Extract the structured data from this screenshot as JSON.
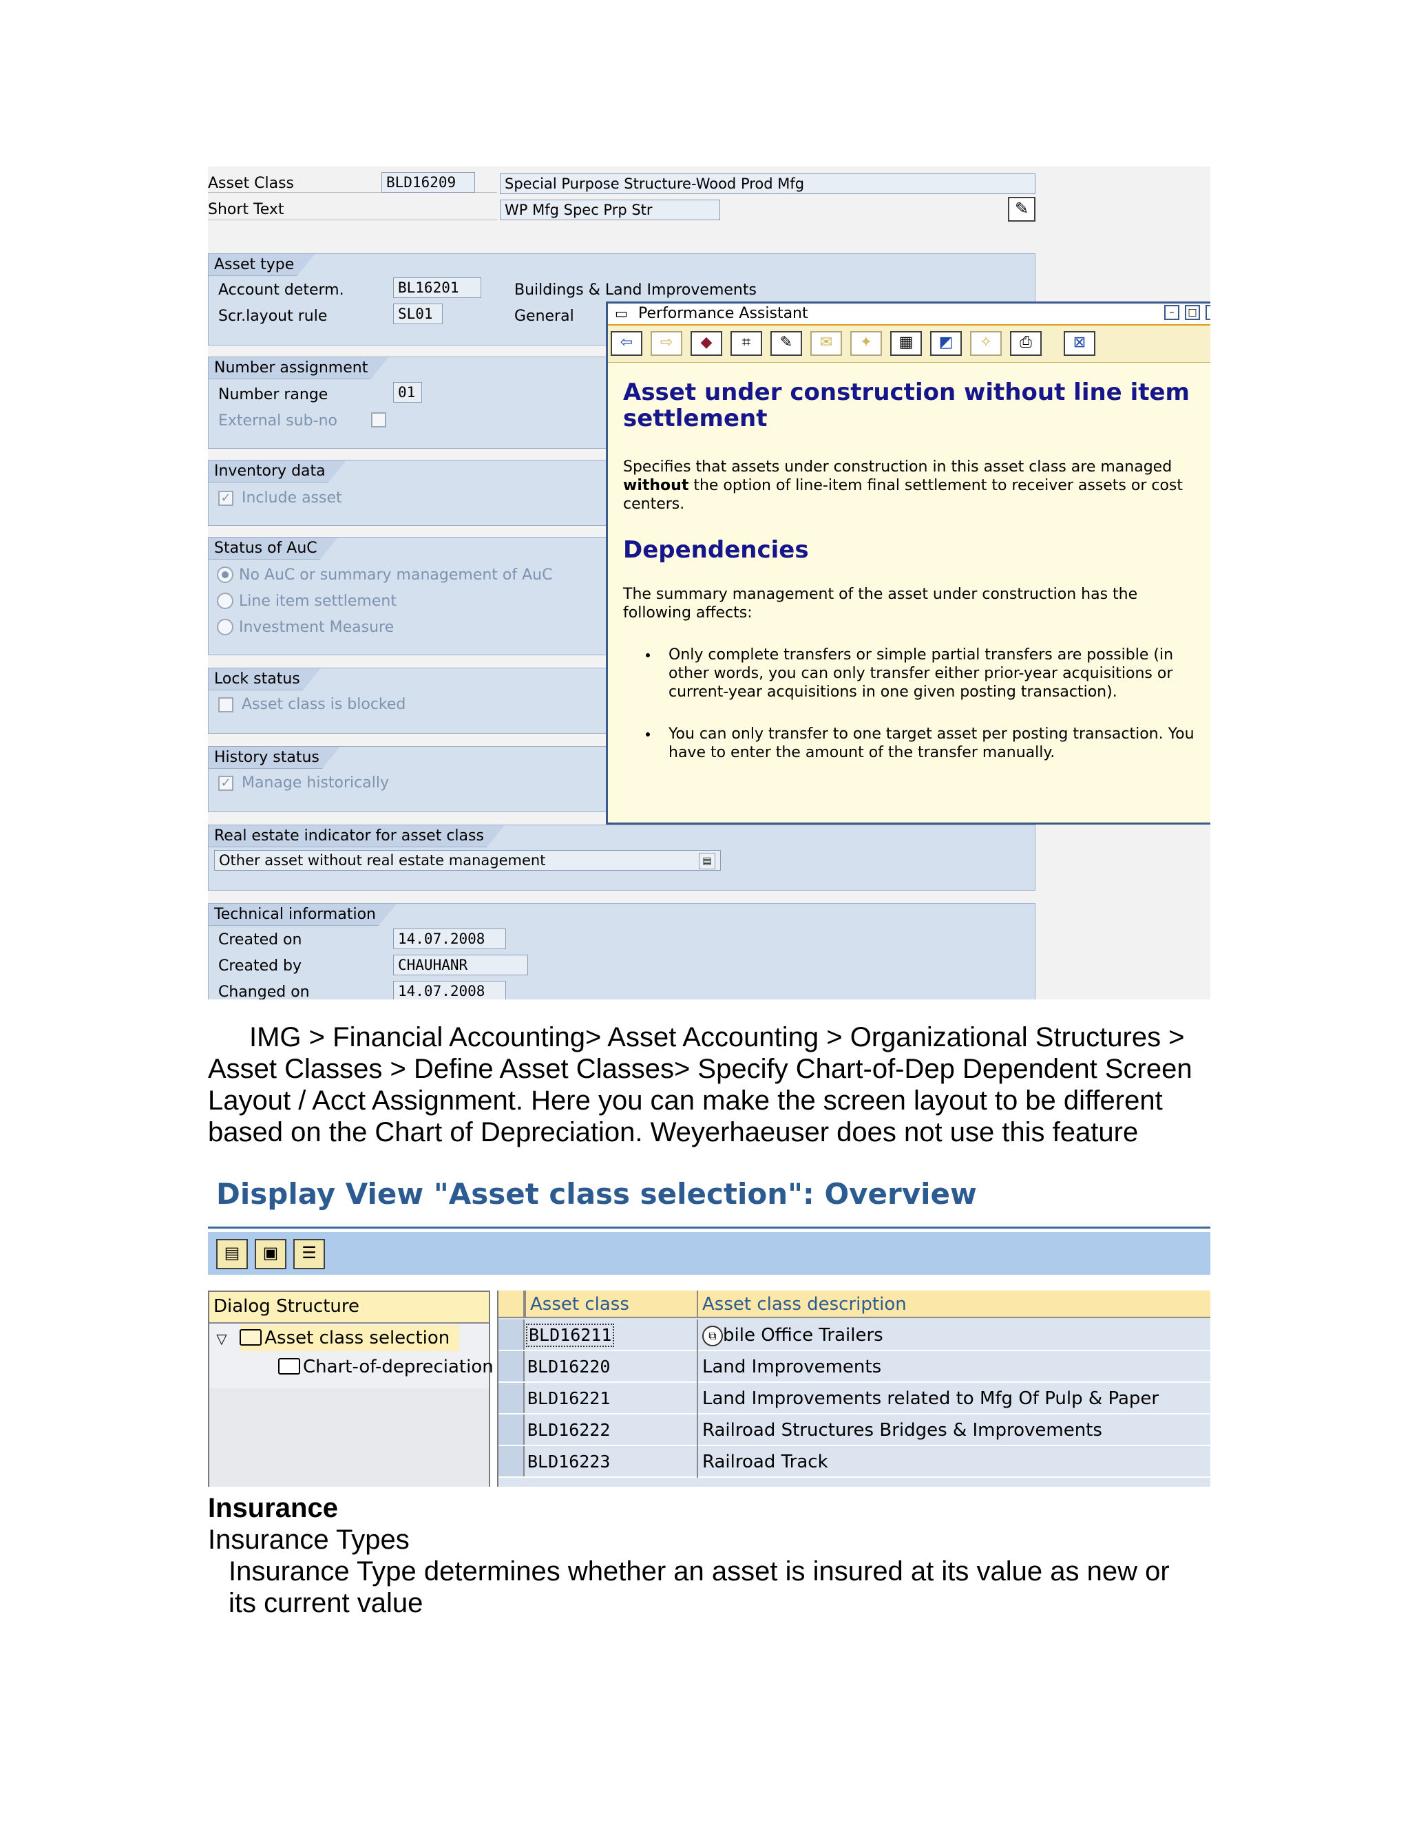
{
  "asset_class_screen": {
    "asset_class_label": "Asset Class",
    "asset_class_value": "BLD16209",
    "asset_class_desc": "Special Purpose Structure-Wood Prod Mfg",
    "short_text_label": "Short Text",
    "short_text_value": "WP Mfg Spec Prp Str",
    "asset_type": {
      "title": "Asset type",
      "account_determ_label": "Account determ.",
      "account_determ_value": "BL16201",
      "account_determ_desc": "Buildings & Land Improvements",
      "scr_layout_label": "Scr.layout rule",
      "scr_layout_value": "SL01",
      "scr_layout_desc": "General"
    },
    "number_assignment": {
      "title": "Number assignment",
      "number_range_label": "Number range",
      "number_range_value": "01",
      "external_subno_label": "External sub-no"
    },
    "inventory_data": {
      "title": "Inventory data",
      "include_asset_label": "Include asset"
    },
    "status_auc": {
      "title": "Status of AuC",
      "options": [
        "No AuC or summary management of AuC",
        "Line item settlement",
        "Investment Measure"
      ]
    },
    "lock_status": {
      "title": "Lock status",
      "blocked_label": "Asset class is blocked"
    },
    "history_status": {
      "title": "History status",
      "manage_label": "Manage historically"
    },
    "real_estate": {
      "title": "Real estate indicator for asset class",
      "value": "Other asset without real estate management"
    },
    "technical": {
      "title": "Technical information",
      "created_on_label": "Created on",
      "created_on_value": "14.07.2008",
      "created_by_label": "Created by",
      "created_by_value": "CHAUHANR",
      "changed_on_label": "Changed on",
      "changed_on_value": "14.07.2008"
    }
  },
  "performance_assistant": {
    "window_title": "Performance Assistant",
    "heading1": "Asset under construction without line item settlement",
    "para1_pre": "Specifies that assets under construction in this asset class are managed ",
    "para1_bold": "without",
    "para1_post": " the option of line-item final settlement to receiver assets or cost centers.",
    "heading2": "Dependencies",
    "para2": "The summary management of the asset under construction has the following affects:",
    "bullets": [
      "Only complete transfers or simple partial transfers are possible (in other words, you can only transfer either prior-year acquisitions or current-year acquisitions in one given posting transaction).",
      "You can only transfer to one target asset per posting transaction. You have to enter the amount of the transfer manually."
    ]
  },
  "body_text": {
    "para_line1": "IMG > Financial Accounting>  Asset Accounting > Organizational Structures >",
    "para_line2": "Asset Classes > Define Asset Classes> Specify Chart-of-Dep Dependent Screen",
    "para_line3": "Layout / Acct Assignment. Here you can make the screen layout to be different",
    "para_line4": "based on the Chart of Depreciation. Weyerhaeuser does not use this feature",
    "heading_insurance": "Insurance",
    "insurance_types": "Insurance Types",
    "insurance_line1": "Insurance Type determines whether an asset is insured at its value as new or",
    "insurance_line2": "its current value"
  },
  "asset_class_selection": {
    "title": "Display View \"Asset class selection\": Overview",
    "dialog_structure": "Dialog Structure",
    "tree_items": [
      "Asset class selection",
      "Chart-of-depreciation"
    ],
    "columns": [
      "Asset class",
      "Asset class description"
    ],
    "rows": [
      {
        "asset_class": "BLD16211",
        "description": "bile Office Trailers"
      },
      {
        "asset_class": "BLD16220",
        "description": "Land Improvements"
      },
      {
        "asset_class": "BLD16221",
        "description": "Land Improvements related to Mfg Of Pulp & Paper"
      },
      {
        "asset_class": "BLD16222",
        "description": "Railroad Structures Bridges &  Improvements"
      },
      {
        "asset_class": "BLD16223",
        "description": "Railroad Track"
      }
    ]
  },
  "colors": {
    "sap_group_bg": "#d5e0ee",
    "pa_heading": "#16168c",
    "title_blue": "#2b5b91",
    "toolbar_blue": "#aecbeb",
    "header_yellow": "#fbe8a8"
  },
  "icons": [
    "edit-icon",
    "back-arrow-icon",
    "forward-arrow-icon",
    "book-icon",
    "print-icon",
    "close-icon",
    "folder-icon",
    "expand-triangle-icon",
    "dropdown-icon"
  ]
}
